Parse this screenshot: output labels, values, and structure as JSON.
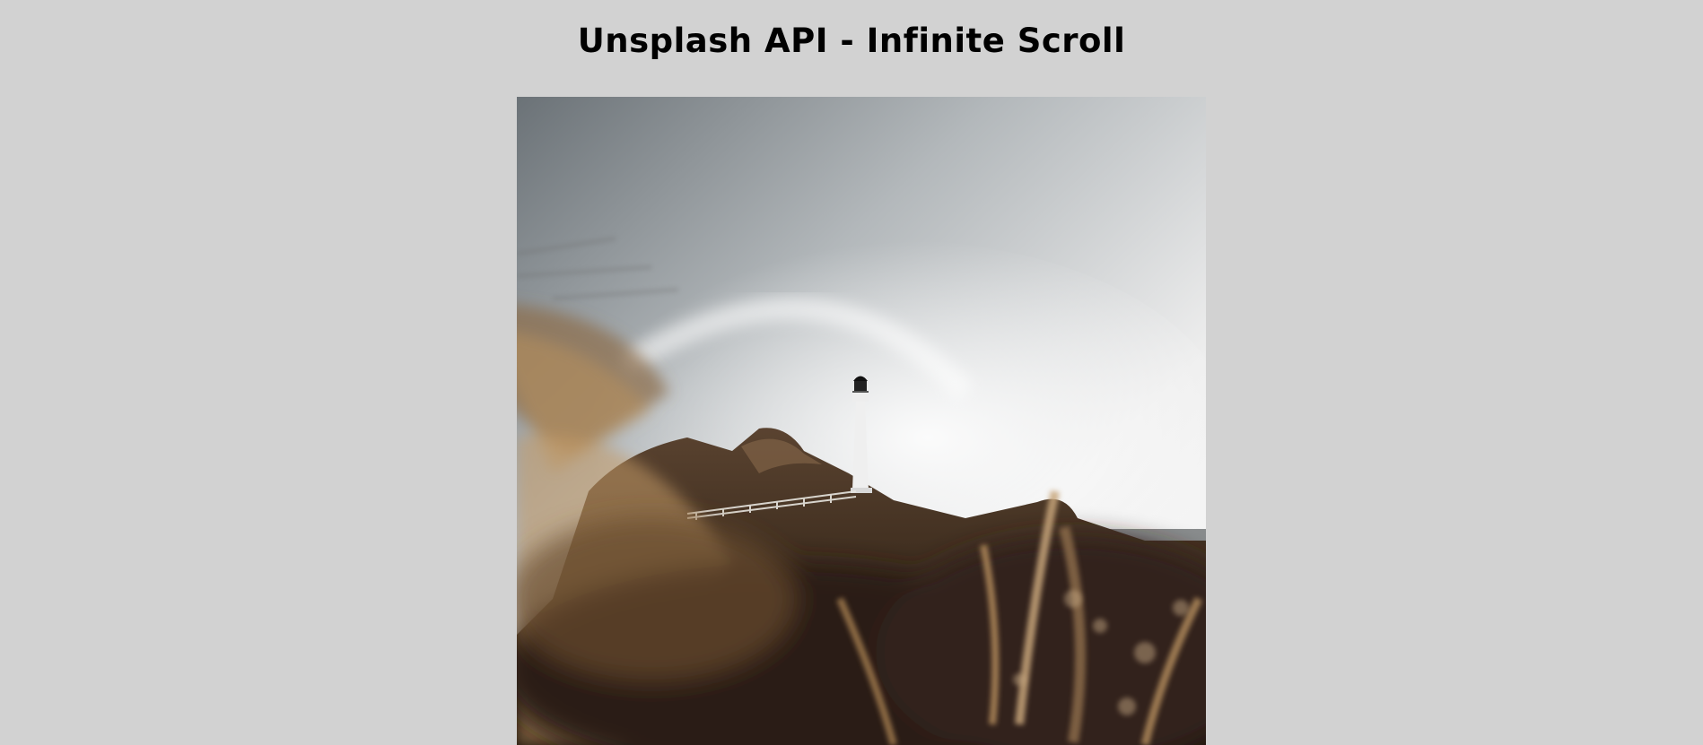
{
  "header": {
    "title": "Unsplash API - Infinite Scroll"
  },
  "gallery": {
    "images": [
      {
        "subject": "lighthouse-on-rocky-hill"
      }
    ]
  },
  "colors": {
    "background": "#d2d2d2",
    "title": "#000000",
    "sky_top": "#6b7277",
    "sky_bright": "#f7f7f7",
    "grass_dark": "#2e2116",
    "grass_light": "#b58f62"
  }
}
